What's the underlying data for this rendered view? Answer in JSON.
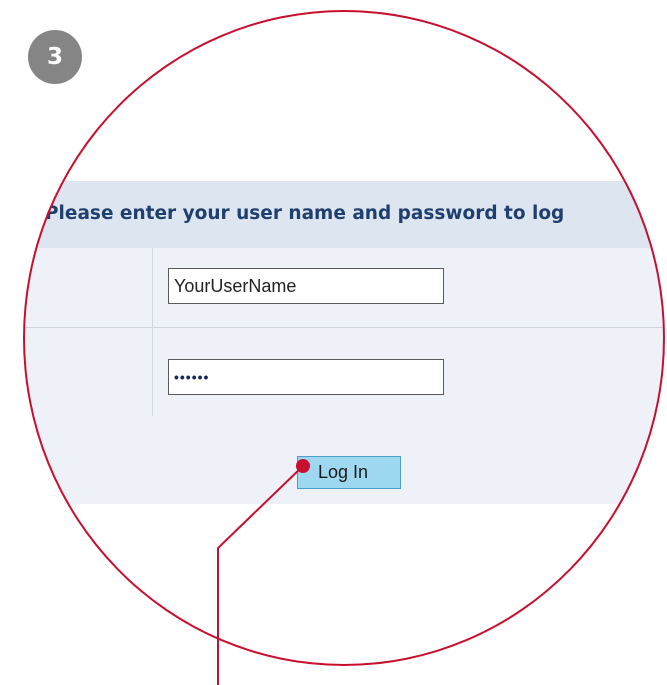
{
  "step": {
    "number": "3"
  },
  "login": {
    "header": "Please enter your user name and password to log",
    "username": {
      "value": "YourUserName"
    },
    "password": {
      "value": "••••••"
    },
    "login_button": "Log In"
  },
  "colors": {
    "callout": "#c8102e",
    "header_bg": "#dde6f0",
    "form_bg": "#eef1f7",
    "button_bg": "#9ed8f0",
    "badge_bg": "#858585"
  }
}
